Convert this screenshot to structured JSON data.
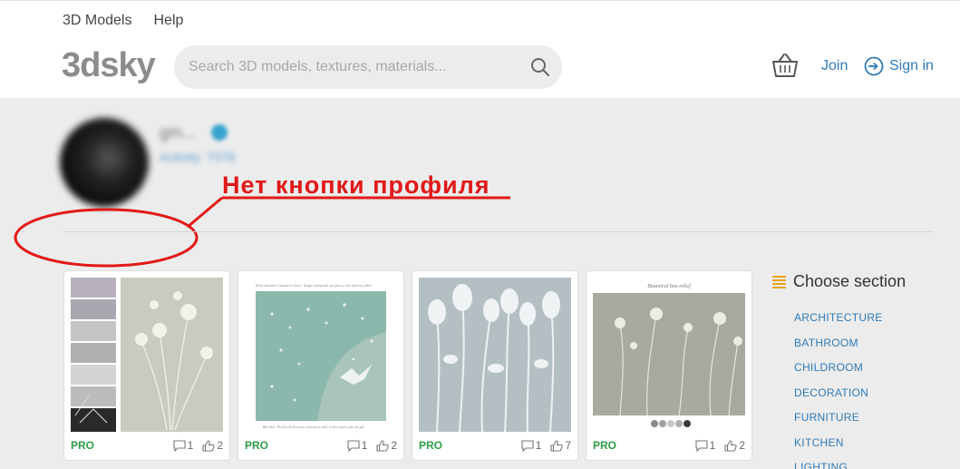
{
  "topnav": {
    "models": "3D Models",
    "help": "Help"
  },
  "logo": "3dsky",
  "search": {
    "placeholder": "Search 3D models, textures, materials..."
  },
  "header_actions": {
    "join": "Join",
    "signin": "Sign in"
  },
  "profile": {
    "name": "gm...",
    "activity": "Activity: 7378"
  },
  "annotation": "Нет кнопки профиля",
  "cards": [
    {
      "pro": "PRO",
      "comments": "1",
      "likes": "2"
    },
    {
      "pro": "PRO",
      "comments": "1",
      "likes": "2",
      "caption_top": "Erotic moments. Customer's choice: design repurposed, any plan, or any reference photo.",
      "caption_bottom": "Blue bird. The blue bird's sweet of barely so solid, it lives only in your air gift."
    },
    {
      "pro": "PRO",
      "comments": "1",
      "likes": "7"
    },
    {
      "pro": "PRO",
      "comments": "1",
      "likes": "2",
      "caption_top": "Botanical bas-relief"
    }
  ],
  "sidebar": {
    "title": "Choose section",
    "items": [
      "ARCHITECTURE",
      "BATHROOM",
      "CHILDROOM",
      "DECORATION",
      "FURNITURE",
      "KITCHEN",
      "LIGHTING"
    ]
  },
  "colors": {
    "accent": "#2e7ab8",
    "pro": "#2e9d47",
    "annotation": "#e21818"
  }
}
